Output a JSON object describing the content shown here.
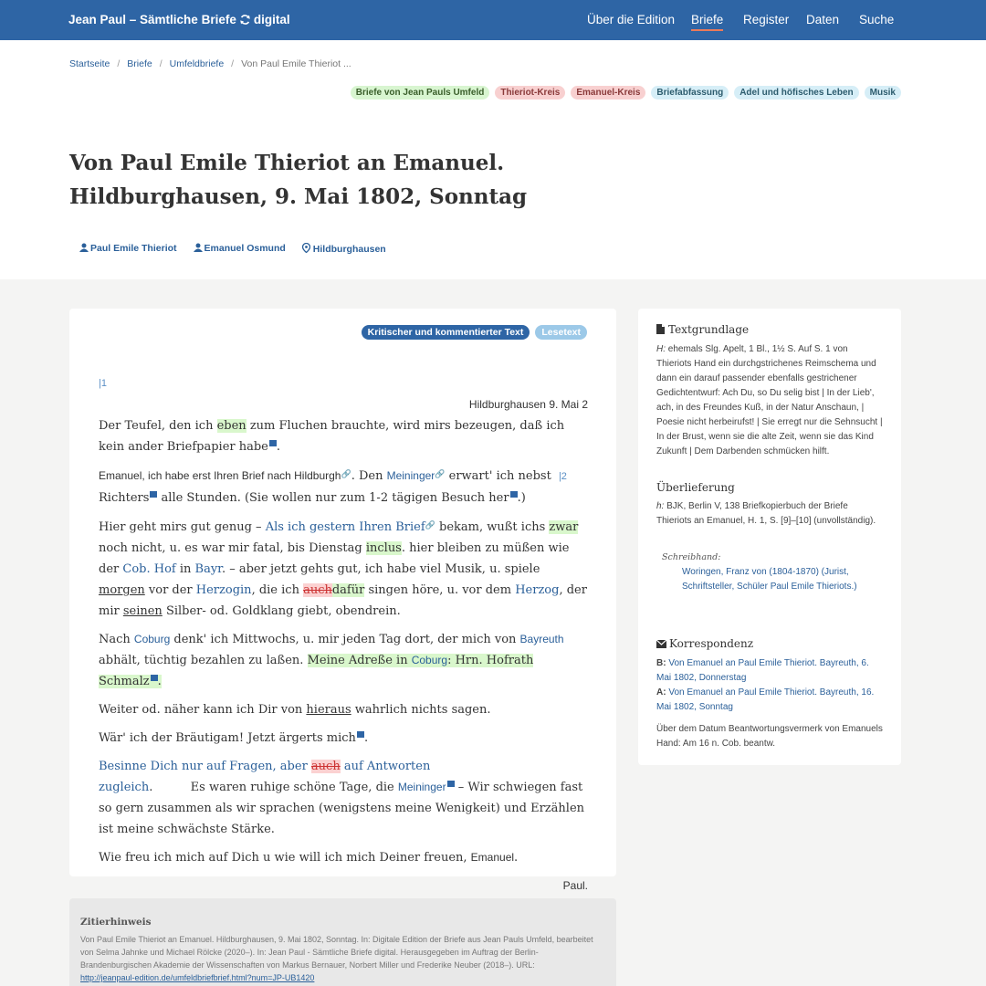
{
  "nav": {
    "brand_prefix": "Jean Paul – Sämtliche Briefe",
    "brand_suffix": "digital",
    "items": [
      "Über die Edition",
      "Briefe",
      "Register",
      "Daten",
      "Suche"
    ],
    "active": "Briefe"
  },
  "breadcrumb": [
    "Startseite",
    "Briefe",
    "Umfeldbriefe",
    "Von Paul Emile Thieriot ..."
  ],
  "tags": [
    {
      "label": "Briefe von Jean Pauls Umfeld",
      "color": "green"
    },
    {
      "label": "Thieriot-Kreis",
      "color": "red"
    },
    {
      "label": "Emanuel-Kreis",
      "color": "red"
    },
    {
      "label": "Briefabfassung",
      "color": "blue"
    },
    {
      "label": "Adel und höfisches Leben",
      "color": "blue"
    },
    {
      "label": "Musik",
      "color": "blue"
    }
  ],
  "title": "Von Paul Emile Thieriot an Emanuel. Hildburghausen, 9. Mai 1802, Sonntag",
  "meta": {
    "sender": "Paul Emile Thieriot",
    "recipient": "Emanuel Osmund",
    "place": "Hildburghausen"
  },
  "views": {
    "primary": "Kritischer und kommentierter Text",
    "secondary": "Lesetext"
  },
  "letter": {
    "page1": "|1",
    "page2": "|2",
    "dateline": "Hildburghausen 9. Mai 2",
    "p1a": "Der Teufel, den ich ",
    "p1hl": "eben",
    "p1b": " zum Fluchen brauchte, wird mirs bezeugen, daß ich kein ander Briefpapier habe",
    "p2a": "Emanuel, ich habe erst Ihren Brief nach Hildburgh",
    "p2b": ". Den ",
    "p2link": "Meininger",
    "p2c": " erwart' ich nebst ",
    "p2d": "Richters",
    "p2e": " alle Stunden. (Sie wollen nur zum 1-2 tägigen Besuch her",
    "p2f": ".)",
    "p3a": "Hier geht mirs gut genug – ",
    "p3link": "Als ich gestern Ihren Brief",
    "p3b": " bekam, wußt ichs ",
    "p3hl1": "zwar",
    "p3c": " noch nicht, u. es war mir fatal, bis Dienstag ",
    "p3hl2": "inclus",
    "p3d": ". hier bleiben zu müßen wie der ",
    "p3link2": "Cob. Hof",
    "p3e": " in ",
    "p3link3": "Bayr",
    "p3f": ". – aber jetzt gehts gut, ich habe viel Musik, u. spiele ",
    "p3u1": "morgen",
    "p3g": " vor der ",
    "p3link4": "Herzogin",
    "p3h": ", die ich ",
    "p3del": "auch",
    "p3ins": "dafür",
    "p3i": " singen höre, u. vor dem ",
    "p3link5": "Herzog",
    "p3j": ", der mir ",
    "p3u2": "seinen",
    "p3k": " Silber- od. Goldklang giebt, obendrein.",
    "p4a": "Nach ",
    "p4link": "Coburg",
    "p4b": " denk' ich Mittwochs, u. mir jeden Tag dort, der mich von ",
    "p4link2": "Bayreuth",
    "p4c": " abhält, tüchtig bezahlen zu laßen. ",
    "p4hl1": "Meine Adreße in ",
    "p4hlLink": "Coburg",
    "p4hl2": ": Hrn. Hofrath Schmalz",
    "p4d": ".",
    "p5a": "Weiter od. näher kann ich Dir von ",
    "p5u": "hieraus",
    "p5b": " wahrlich nichts sagen.",
    "p6": "Wär' ich der Bräutigam! Jetzt ärgerts mich",
    "p6end": ".",
    "p7link1": "Besinne Dich nur auf Fragen, aber ",
    "p7del": "auch",
    "p7link2": " auf Antworten zugleich",
    "p7a": ".          Es waren ruhige schöne Tage, die ",
    "p7link3": "Meininger",
    "p7b": " – Wir schwiegen fast so gern zusammen als wir sprachen (wenigstens meine Wenigkeit) und Erzählen ist meine schwächste Stärke.",
    "p8": "Wie freu ich mich auf Dich u wie will ich mich Deiner freuen, ",
    "p8name": "Emanuel",
    "p8end": ".",
    "signature": "Paul."
  },
  "sidebar": {
    "textgrundlage_heading": "Textgrundlage",
    "textgrundlage_h": "H:",
    "textgrundlage_text": " ehemals Slg. Apelt, 1 Bl., 1½ S. Auf S. 1 von Thieriots Hand ein durchgstrichenes Reimschema und dann ein darauf passender ebenfalls gestrichener Gedichtentwurf: Ach Du, so Du selig bist | In der Lieb', ach, in des Freundes Kuß, in der Natur Anschaun, | Poesie nicht herbeirufst! | Sie erregt nur die Sehnsucht | In der Brust, wenn sie die alte Zeit, wenn sie das Kind Zukunft | Dem Darbenden schmücken hilft.",
    "ueberlieferung_heading": "Überlieferung",
    "ueberlieferung_h": "h:",
    "ueberlieferung_text": " BJK, Berlin V, 138 Briefkopierbuch der Briefe Thieriots an Emanuel, H. 1, S. [9]–[10] (unvollständig).",
    "schreibhand_label": "Schreibhand:",
    "schreibhand_value": "Woringen, Franz von (1804-1870) (Jurist, Schriftsteller, Schüler Paul Emile Thieriots.)",
    "korrespondenz_heading": "Korrespondenz",
    "b_label": "B:",
    "b_link": "Von Emanuel an Paul Emile Thieriot. Bayreuth, 6. Mai 1802, Donnerstag",
    "a_label": "A:",
    "a_link": "Von Emanuel an Paul Emile Thieriot. Bayreuth, 16. Mai 1802, Sonntag",
    "note": "Über dem Datum Beantwortungsvermerk von Emanuels Hand: Am 16 n. Cob. beantw."
  },
  "citation": {
    "heading": "Zitierhinweis",
    "text": "Von Paul Emile Thieriot an Emanuel. Hildburghausen, 9. Mai 1802, Sonntag. In: Digitale Edition der Briefe aus Jean Pauls Umfeld, bearbeitet von Selma Jahnke und Michael Rölcke (2020–). In: Jean Paul - Sämtliche Briefe digital. Herausgegeben im Auftrag der Berlin-Brandenburgischen Akademie der Wissenschaften von Markus Bernauer, Norbert Miller und Frederike Neuber (2018–). URL:",
    "url": "http://jeanpaul-edition.de/umfeldbriefbrief.html?num=JP-UB1420"
  },
  "colors": {
    "navbar": "#2e65a5",
    "link": "#2a5f99",
    "active_underline": "#ea7a5a",
    "highlight_green": "#d9f7cc",
    "highlight_red": "#fbd1d1"
  }
}
